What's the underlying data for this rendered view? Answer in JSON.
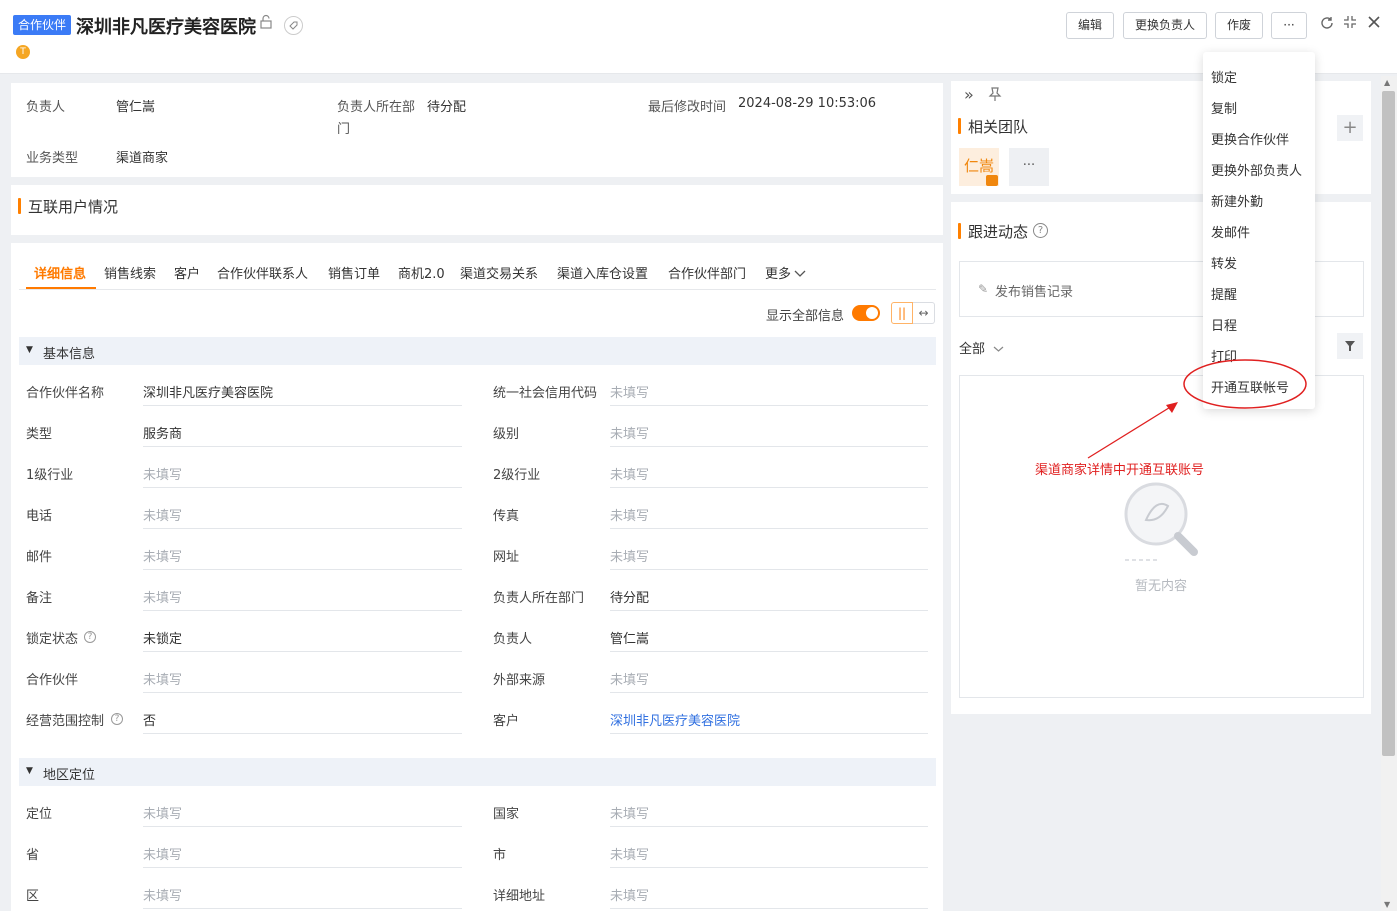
{
  "header": {
    "badge": "合作伙伴",
    "title": "深圳非凡医疗美容医院",
    "status_dot": "T",
    "buttons": {
      "edit": "编辑",
      "change_owner": "更换负责人",
      "void": "作废",
      "more": "···"
    }
  },
  "summary": {
    "owner_label": "负责人",
    "owner_value": "管仁嵩",
    "dept_label_1": "负责人所在部",
    "dept_label_2": "门",
    "dept_value": "待分配",
    "modified_label": "最后修改时间",
    "modified_value": "2024-08-29 10:53:06",
    "biz_label": "业务类型",
    "biz_value": "渠道商家"
  },
  "section_interconnect": "互联用户情况",
  "tabs": [
    "详细信息",
    "销售线索",
    "客户",
    "合作伙伴联系人",
    "销售订单",
    "商机2.0",
    "渠道交易关系",
    "渠道入库仓设置",
    "合作伙伴部门",
    "更多"
  ],
  "show_all_label": "显示全部信息",
  "groups": {
    "basic": "基本信息",
    "region": "地区定位"
  },
  "basic_fields": [
    {
      "ll": "合作伙伴名称",
      "lv": "深圳非凡医疗美容医院",
      "rl": "统一社会信用代码",
      "rv": "未填写"
    },
    {
      "ll": "类型",
      "lv": "服务商",
      "rl": "级别",
      "rv": "未填写"
    },
    {
      "ll": "1级行业",
      "lv": "未填写",
      "rl": "2级行业",
      "rv": "未填写"
    },
    {
      "ll": "电话",
      "lv": "未填写",
      "rl": "传真",
      "rv": "未填写"
    },
    {
      "ll": "邮件",
      "lv": "未填写",
      "rl": "网址",
      "rv": "未填写"
    },
    {
      "ll": "备注",
      "lv": "未填写",
      "rl": "负责人所在部门",
      "rv": "待分配"
    },
    {
      "ll": "锁定状态",
      "lv": "未锁定",
      "rl": "负责人",
      "rv": "管仁嵩"
    },
    {
      "ll": "合作伙伴",
      "lv": "未填写",
      "rl": "外部来源",
      "rv": "未填写"
    },
    {
      "ll": "经营范围控制",
      "lv": "否",
      "rl": "客户",
      "rv": "深圳非凡医疗美容医院"
    }
  ],
  "region_fields": [
    {
      "ll": "定位",
      "lv": "未填写",
      "rl": "国家",
      "rv": "未填写"
    },
    {
      "ll": "省",
      "lv": "未填写",
      "rl": "市",
      "rv": "未填写"
    },
    {
      "ll": "区",
      "lv": "未填写",
      "rl": "详细地址",
      "rv": "未填写"
    }
  ],
  "right": {
    "team_title": "相关团队",
    "avatar_text": "仁嵩",
    "more_dots": "···",
    "follow_title": "跟进动态",
    "publish_label": "发布销售记录",
    "filter_all": "全部",
    "empty_text": "暂无内容"
  },
  "menu_items": [
    "锁定",
    "复制",
    "更换合作伙伴",
    "更换外部负责人",
    "新建外勤",
    "发邮件",
    "转发",
    "提醒",
    "日程",
    "打印",
    "开通互联帐号"
  ],
  "annotation": "渠道商家详情中开通互联账号",
  "colors": {
    "accent": "#ff7a00",
    "brand_blue": "#3b7bf6",
    "annotation_red": "#e02020"
  }
}
